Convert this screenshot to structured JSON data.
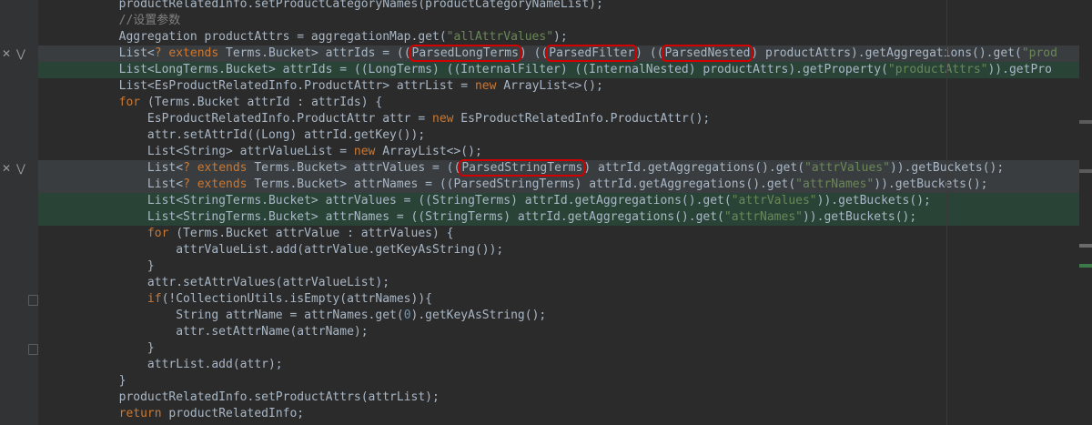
{
  "gutter": {
    "reject_glyph": "✕",
    "accept_glyph": "⋁"
  },
  "lines": [
    {
      "parts": [
        {
          "t": "        productRelatedInfo.setProductCategoryNames(productCategoryNameList);",
          "c": "cls"
        }
      ]
    },
    {
      "parts": [
        {
          "t": "        //设置参数",
          "c": "cmt"
        }
      ]
    },
    {
      "parts": [
        {
          "t": "        Aggregation productAttrs = aggregationMap.get(",
          "c": ""
        },
        {
          "t": "\"allAttrValues\"",
          "c": "str"
        },
        {
          "t": ");",
          "c": ""
        }
      ]
    },
    {
      "kind": "del",
      "marks": true,
      "parts": [
        {
          "t": "        List<",
          "c": ""
        },
        {
          "t": "? extends",
          "c": "kw"
        },
        {
          "t": " Terms.Bucket> attrIds = ((",
          "c": ""
        },
        {
          "t": "ParsedLongTerms",
          "c": "",
          "box": true
        },
        {
          "t": ") ((",
          "c": ""
        },
        {
          "t": "ParsedFilter",
          "c": "",
          "box": true
        },
        {
          "t": ") ((",
          "c": ""
        },
        {
          "t": "ParsedNested",
          "c": "",
          "box": true
        },
        {
          "t": ") productAttrs).getAggregations().get(",
          "c": ""
        },
        {
          "t": "\"prod",
          "c": "str"
        }
      ]
    },
    {
      "kind": "add",
      "parts": [
        {
          "t": "        List<LongTerms.Bucket> attrIds = ((LongTerms) ((InternalFilter) ((InternalNested) productAttrs).getProperty(",
          "c": ""
        },
        {
          "t": "\"productAttrs\"",
          "c": "str"
        },
        {
          "t": ")).getPro",
          "c": ""
        }
      ]
    },
    {
      "parts": [
        {
          "t": "        List<EsProductRelatedInfo.ProductAttr> attrList = ",
          "c": ""
        },
        {
          "t": "new",
          "c": "kw"
        },
        {
          "t": " ArrayList<>();",
          "c": ""
        }
      ]
    },
    {
      "parts": [
        {
          "t": "        ",
          "c": ""
        },
        {
          "t": "for",
          "c": "kw"
        },
        {
          "t": " (Terms.Bucket attrId : attrIds) {",
          "c": ""
        }
      ]
    },
    {
      "parts": [
        {
          "t": "            EsProductRelatedInfo.ProductAttr attr = ",
          "c": ""
        },
        {
          "t": "new",
          "c": "kw"
        },
        {
          "t": " EsProductRelatedInfo.ProductAttr();",
          "c": ""
        }
      ]
    },
    {
      "parts": [
        {
          "t": "            attr.setAttrId((Long) attrId.getKey());",
          "c": ""
        }
      ]
    },
    {
      "parts": [
        {
          "t": "            List<String> attrValueList = ",
          "c": ""
        },
        {
          "t": "new",
          "c": "kw"
        },
        {
          "t": " ArrayList<>();",
          "c": ""
        }
      ]
    },
    {
      "kind": "del",
      "marks": true,
      "parts": [
        {
          "t": "            List<",
          "c": ""
        },
        {
          "t": "? extends",
          "c": "kw"
        },
        {
          "t": " Terms.Bucket> attrValues = ((",
          "c": ""
        },
        {
          "t": "ParsedStringTerms",
          "c": "",
          "box": true
        },
        {
          "t": ") attrId.getAggregations().get(",
          "c": ""
        },
        {
          "t": "\"attrValues\"",
          "c": "str"
        },
        {
          "t": ")).getBuckets();",
          "c": ""
        }
      ]
    },
    {
      "kind": "del",
      "parts": [
        {
          "t": "            List<",
          "c": ""
        },
        {
          "t": "? extends",
          "c": "kw"
        },
        {
          "t": " Terms.Bucket> attrNames = ((ParsedStringTerms) attrId.getAggregations().get(",
          "c": ""
        },
        {
          "t": "\"attrNames\"",
          "c": "str"
        },
        {
          "t": ")).getBuckets();",
          "c": ""
        }
      ]
    },
    {
      "kind": "add",
      "parts": [
        {
          "t": "            List<StringTerms.Bucket> attrValues = ((StringTerms) attrId.getAggregations().get(",
          "c": ""
        },
        {
          "t": "\"attrValues\"",
          "c": "str"
        },
        {
          "t": ")).getBuckets();",
          "c": ""
        }
      ]
    },
    {
      "kind": "add",
      "parts": [
        {
          "t": "            List<StringTerms.Bucket> attrNames = ((StringTerms) attrId.getAggregations().get(",
          "c": ""
        },
        {
          "t": "\"attrNames\"",
          "c": "str"
        },
        {
          "t": ")).getBuckets();",
          "c": ""
        }
      ]
    },
    {
      "parts": [
        {
          "t": "            ",
          "c": ""
        },
        {
          "t": "for",
          "c": "kw"
        },
        {
          "t": " (Terms.Bucket attrValue : attrValues) {",
          "c": ""
        }
      ]
    },
    {
      "parts": [
        {
          "t": "                attrValueList.add(attrValue.getKeyAsString());",
          "c": ""
        }
      ]
    },
    {
      "parts": [
        {
          "t": "            }",
          "c": ""
        }
      ]
    },
    {
      "parts": [
        {
          "t": "            attr.setAttrValues(attrValueList);",
          "c": ""
        }
      ]
    },
    {
      "parts": [
        {
          "t": "            ",
          "c": ""
        },
        {
          "t": "if",
          "c": "kw"
        },
        {
          "t": "(!CollectionUtils.isEmpty(attrNames)){",
          "c": ""
        }
      ]
    },
    {
      "parts": [
        {
          "t": "                String attrName = attrNames.get(",
          "c": ""
        },
        {
          "t": "0",
          "c": "num"
        },
        {
          "t": ").getKeyAsString();",
          "c": ""
        }
      ]
    },
    {
      "parts": [
        {
          "t": "                attr.setAttrName(attrName);",
          "c": ""
        }
      ]
    },
    {
      "parts": [
        {
          "t": "            }",
          "c": ""
        }
      ]
    },
    {
      "parts": [
        {
          "t": "            attrList.add(attr);",
          "c": ""
        }
      ]
    },
    {
      "parts": [
        {
          "t": "        }",
          "c": ""
        }
      ]
    },
    {
      "parts": [
        {
          "t": "        productRelatedInfo.setProductAttrs(attrList);",
          "c": ""
        }
      ]
    },
    {
      "parts": [
        {
          "t": "        ",
          "c": ""
        },
        {
          "t": "return",
          "c": "kw"
        },
        {
          "t": " productRelatedInfo;",
          "c": ""
        }
      ]
    }
  ]
}
